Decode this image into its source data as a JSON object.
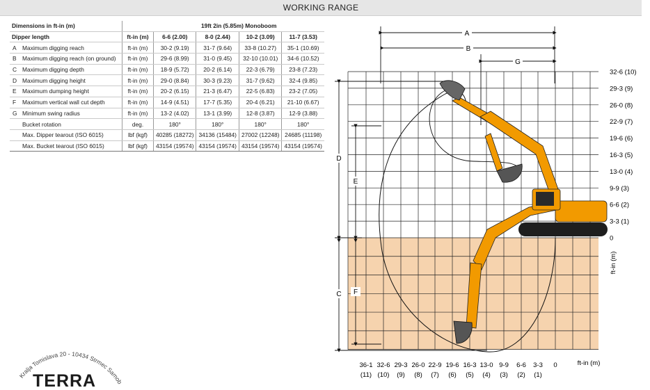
{
  "header": {
    "title": "WORKING RANGE"
  },
  "table": {
    "dims_label": "Dimensions in ft-in (m)",
    "boom_label": "19ft 2in (5.85m) Monoboom",
    "dipper_label": "Dipper length",
    "unit_header": "ft-in (m)",
    "dipper_values": [
      "6-6 (2.00)",
      "8-0 (2.44)",
      "10-2 (3.09)",
      "11-7 (3.53)"
    ],
    "rows": [
      {
        "code": "A",
        "label": "Maximum digging reach",
        "unit": "ft-in (m)",
        "values": [
          "30-2 (9.19)",
          "31-7 (9.64)",
          "33-8 (10.27)",
          "35-1 (10.69)"
        ]
      },
      {
        "code": "B",
        "label": "Maximum digging reach (on ground)",
        "unit": "ft-in (m)",
        "values": [
          "29-6 (8.99)",
          "31-0 (9.45)",
          "32-10 (10.01)",
          "34-6 (10.52)"
        ]
      },
      {
        "code": "C",
        "label": "Maximum digging depth",
        "unit": "ft-in (m)",
        "values": [
          "18-9 (5.72)",
          "20-2 (6.14)",
          "22-3 (6.79)",
          "23-8 (7.23)"
        ]
      },
      {
        "code": "D",
        "label": "Maximum digging height",
        "unit": "ft-in (m)",
        "values": [
          "29-0 (8.84)",
          "30-3 (9.23)",
          "31-7 (9.62)",
          "32-4 (9.85)"
        ]
      },
      {
        "code": "E",
        "label": "Maximum dumping height",
        "unit": "ft-in (m)",
        "values": [
          "20-2 (6.15)",
          "21-3 (6.47)",
          "22-5 (6.83)",
          "23-2 (7.05)"
        ]
      },
      {
        "code": "F",
        "label": "Maximum vertical wall cut depth",
        "unit": "ft-in (m)",
        "values": [
          "14-9 (4.51)",
          "17-7 (5.35)",
          "20-4 (6.21)",
          "21-10 (6.67)"
        ]
      },
      {
        "code": "G",
        "label": "Minimum swing radius",
        "unit": "ft-in (m)",
        "values": [
          "13-2 (4.02)",
          "13-1 (3.99)",
          "12-8 (3.87)",
          "12-9 (3.88)"
        ]
      },
      {
        "code": "",
        "label": "Bucket rotation",
        "unit": "deg.",
        "values": [
          "180°",
          "180°",
          "180°",
          "180°"
        ]
      },
      {
        "code": "",
        "label": "Max. Dipper tearout (ISO 6015)",
        "unit": "lbf (kgf)",
        "values": [
          "40285 (18272)",
          "34136 (15484)",
          "27002 (12248)",
          "24685 (11198)"
        ]
      },
      {
        "code": "",
        "label": "Max. Bucket tearout (ISO 6015)",
        "unit": "lbf (kgf)",
        "values": [
          "43154 (19574)",
          "43154 (19574)",
          "43154 (19574)",
          "43154 (19574)"
        ]
      }
    ]
  },
  "diagram": {
    "dim_letters": {
      "a": "A",
      "b": "B",
      "g": "G",
      "d": "D",
      "e": "E",
      "c": "C",
      "f": "F"
    },
    "y_ticks": [
      "32-6 (10)",
      "29-3 (9)",
      "26-0 (8)",
      "22-9 (7)",
      "19-6 (6)",
      "16-3 (5)",
      "13-0 (4)",
      "9-9 (3)",
      "6-6 (2)",
      "3-3 (1)",
      "0"
    ],
    "y_axis_label": "ft-in (m)",
    "x_ticks_ft": [
      "36-1",
      "32-6",
      "29-3",
      "26-0",
      "22-9",
      "19-6",
      "16-3",
      "13-0",
      "9-9",
      "6-6",
      "3-3",
      "0"
    ],
    "x_ticks_m": [
      "(11)",
      "(10)",
      "(9)",
      "(8)",
      "(7)",
      "(6)",
      "(5)",
      "(4)",
      "(3)",
      "(2)",
      "(1)",
      ""
    ],
    "x_axis_label": "ft-in (m)",
    "colors": {
      "ground": "#f6d3ae",
      "machine": "#f29a00",
      "machine_dark": "#1e1e1e",
      "grid": "#222222",
      "brand": "#c8102e"
    }
  },
  "logo": {
    "name": "TERRA",
    "address_text": "Kralja Tomislava 20 - 10434 Strmec Samobor"
  }
}
